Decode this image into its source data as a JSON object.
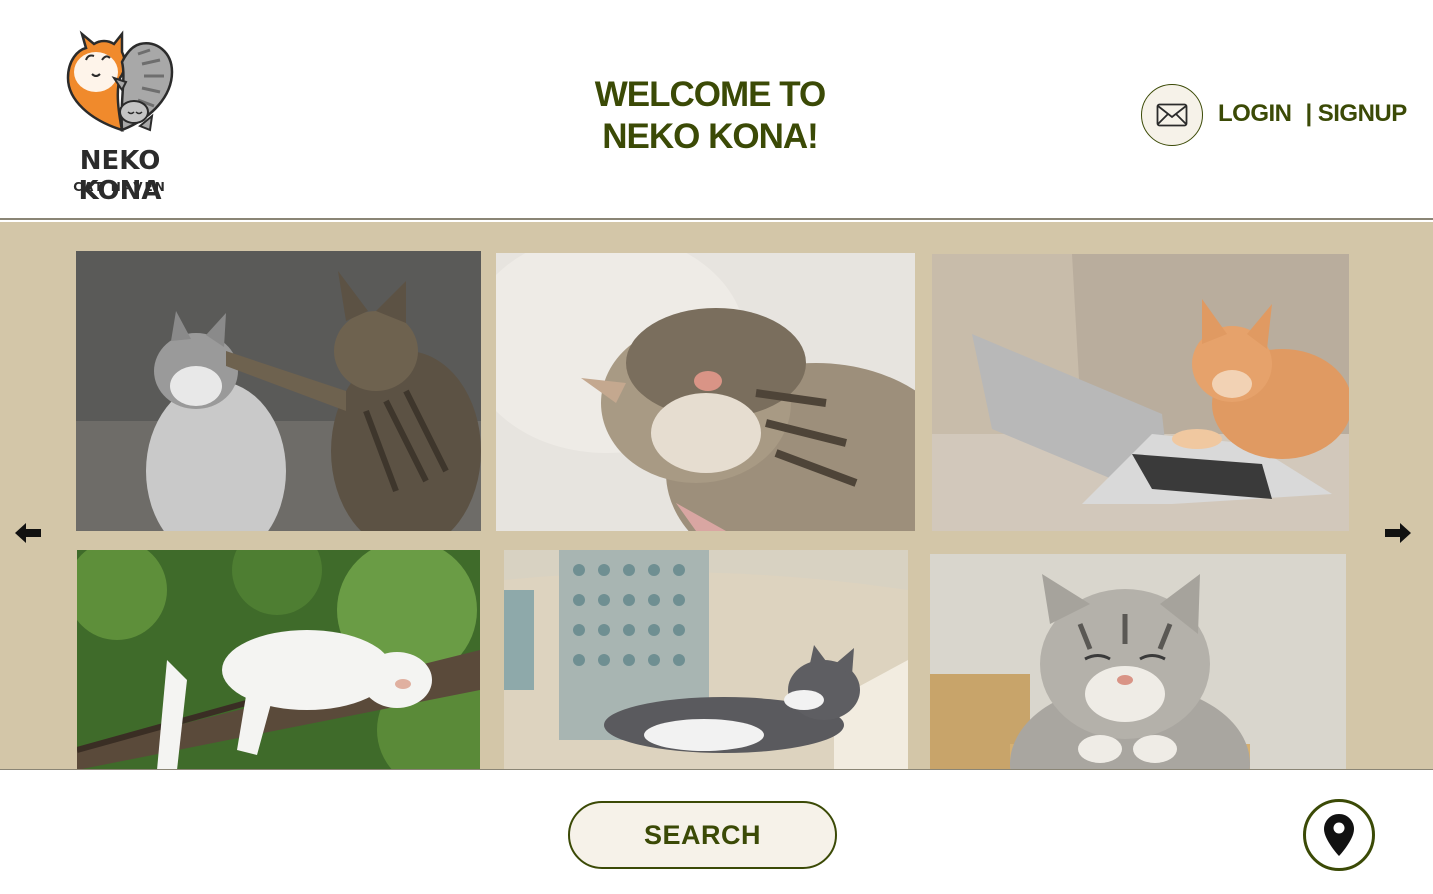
{
  "brand": {
    "name": "NEKO KONA",
    "tagline": "CAT HAVEN"
  },
  "header": {
    "welcome_line1": "WELCOME TO",
    "welcome_line2": "NEKO KONA!",
    "login_label": "LOGIN",
    "separator": "|",
    "signup_label": "SIGNUP",
    "mail_icon": "envelope-icon"
  },
  "gallery": {
    "prev_icon": "arrow-left-icon",
    "next_icon": "arrow-right-icon",
    "photos": [
      {
        "subject": "tabby-cat-patting-kitten"
      },
      {
        "subject": "tabby-cat-covering-face"
      },
      {
        "subject": "orange-cat-on-laptop"
      },
      {
        "subject": "white-cat-sleeping-on-branch"
      },
      {
        "subject": "gray-cat-lounging-on-sofa"
      },
      {
        "subject": "silver-tabby-cat-smiling"
      }
    ]
  },
  "footer": {
    "search_label": "SEARCH",
    "location_icon": "map-pin-icon"
  },
  "colors": {
    "accent": "#3b4a06",
    "gallery_bg": "#d3c6a8",
    "button_bg": "#f6f2e9"
  }
}
